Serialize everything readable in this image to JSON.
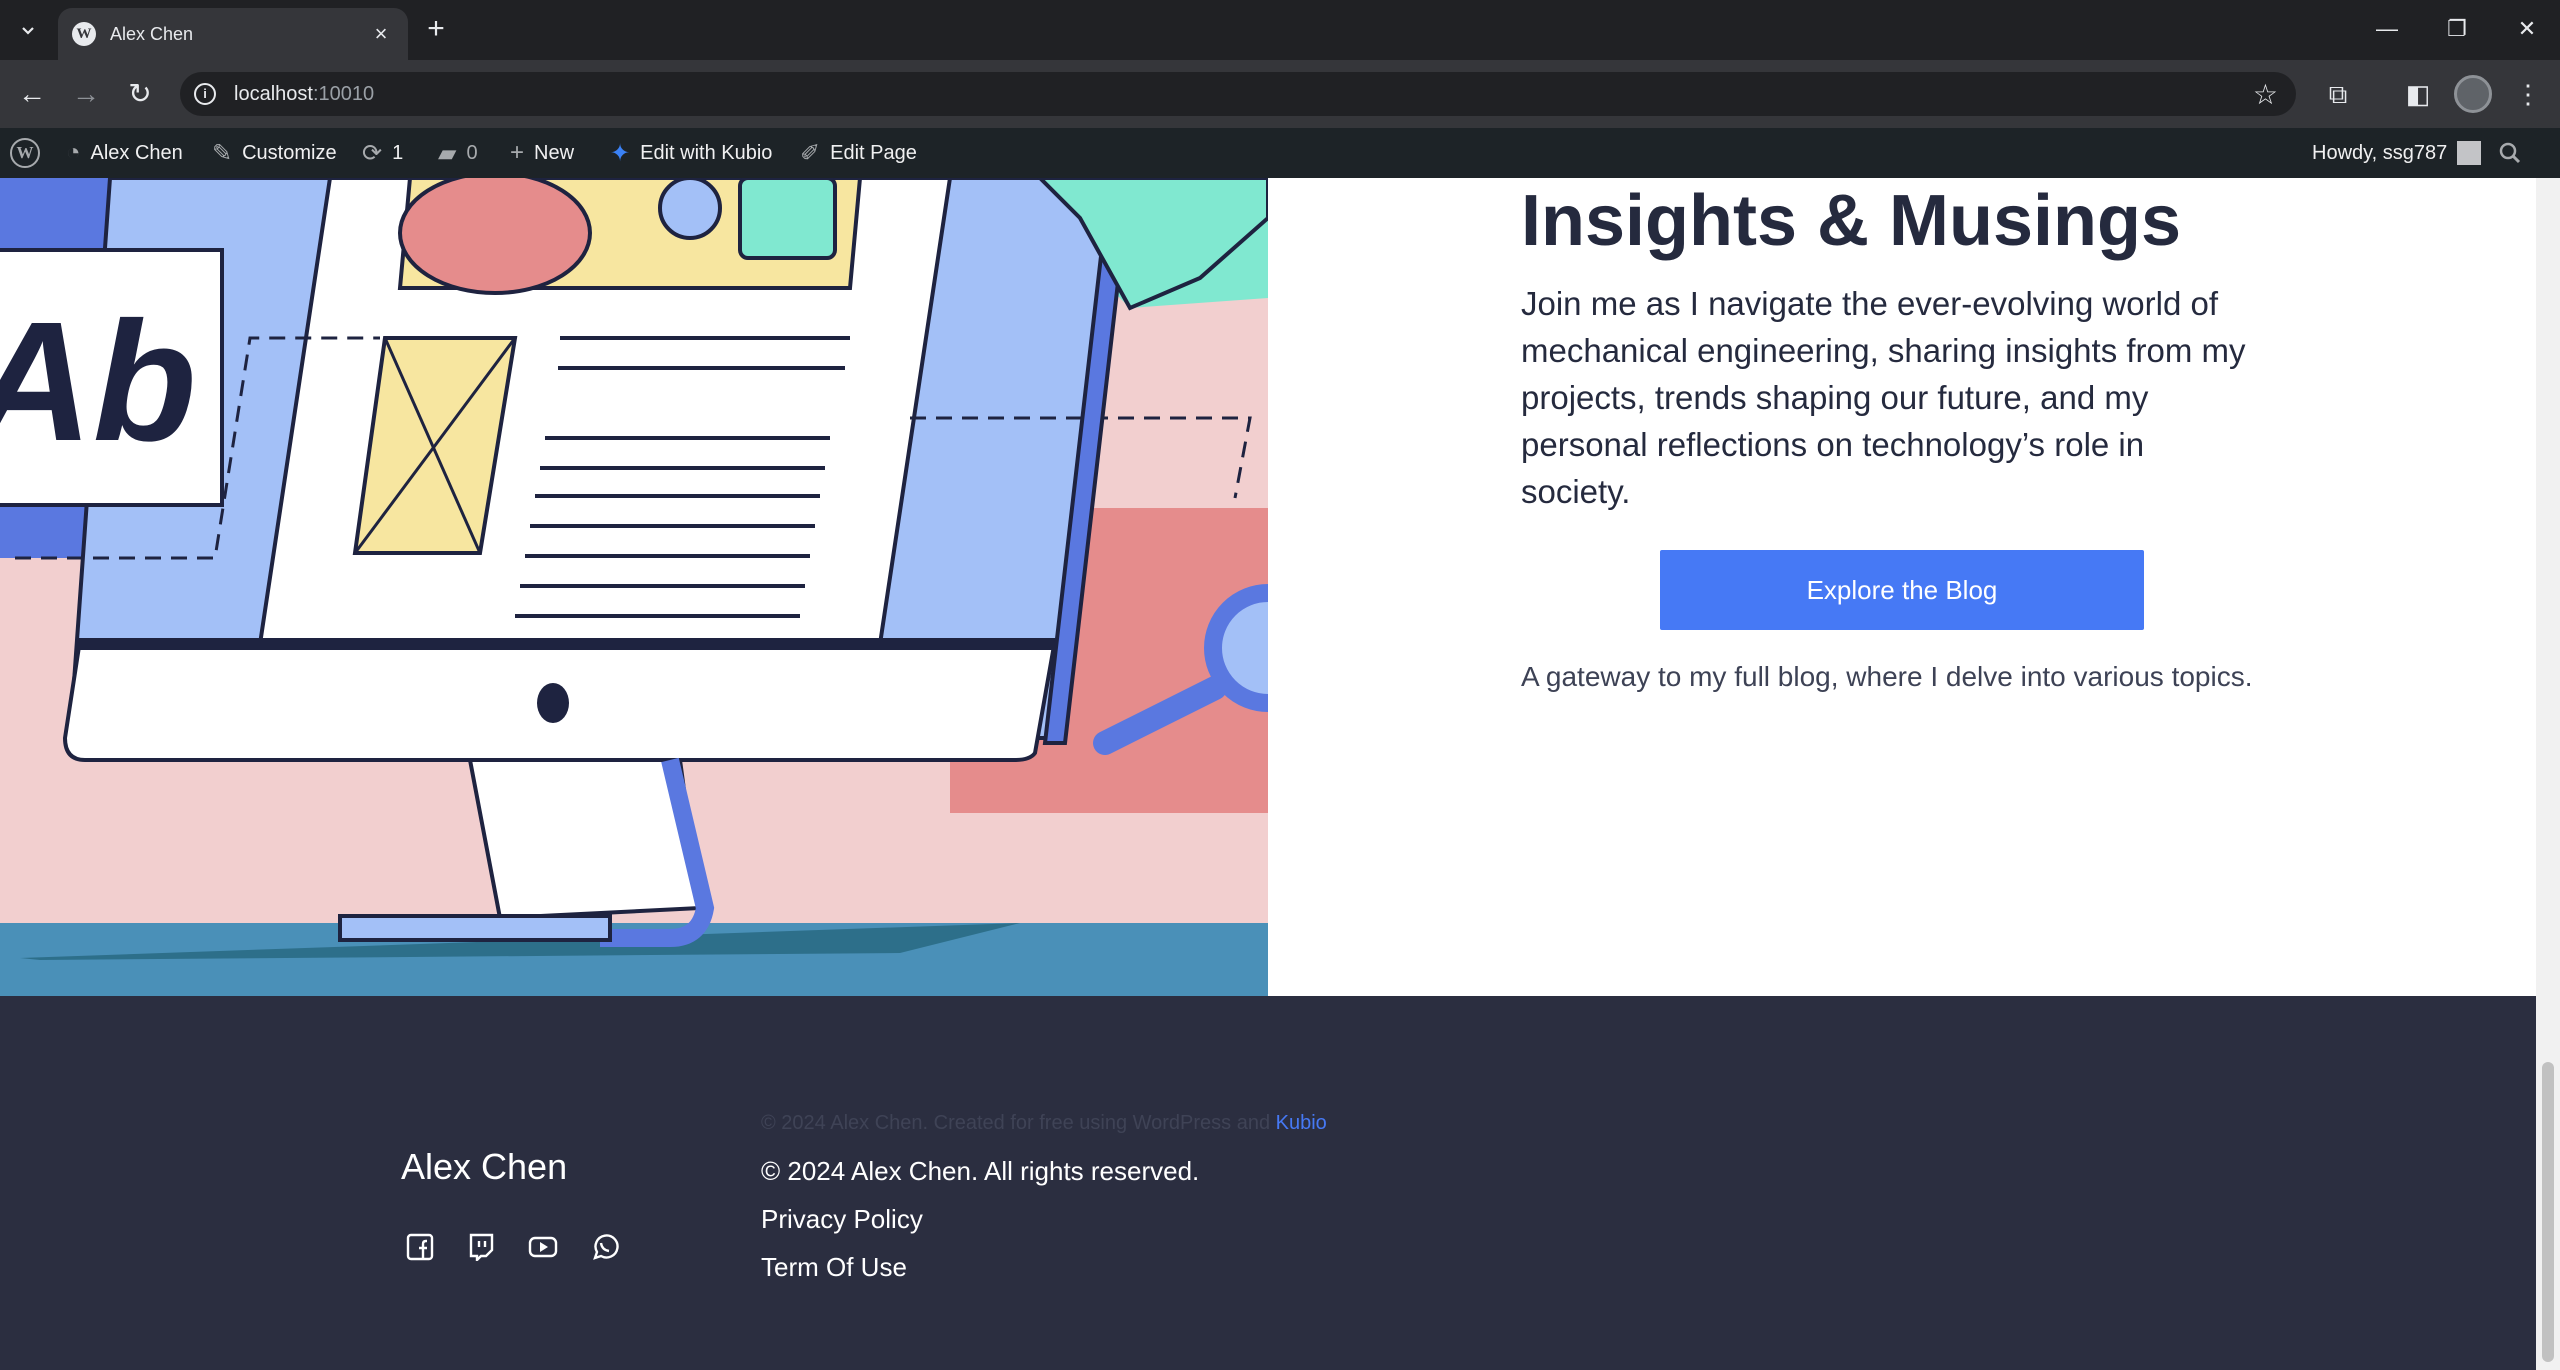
{
  "browser": {
    "tab_title": "Alex Chen",
    "url_host": "localhost",
    "url_port": ":10010"
  },
  "admin_bar": {
    "site_name": "Alex Chen",
    "customize": "Customize",
    "updates": "1",
    "comments": "0",
    "new": "New",
    "edit_kubio": "Edit with Kubio",
    "edit_page": "Edit Page",
    "howdy": "Howdy, ssg787"
  },
  "hero": {
    "title": "Insights & Musings",
    "body": "Join me as I navigate the ever-evolving world of mechanical engineering, sharing insights from my projects, trends shaping our future, and my personal reflections on technology’s role in society.",
    "button": "Explore the Blog",
    "caption": "A gateway to my full blog, where I delve into various topics."
  },
  "footer": {
    "brand": "Alex Chen",
    "credit_text": "© 2024 Alex Chen. Created for free using WordPress and",
    "credit_link": "Kubio",
    "rights": "© 2024 Alex Chen. All rights reserved.",
    "privacy": "Privacy Policy",
    "terms": "Term Of Use",
    "social_icons": [
      "facebook-icon",
      "twitch-icon",
      "youtube-icon",
      "whatsapp-icon"
    ]
  },
  "colors": {
    "accent": "#4679f5",
    "footer_bg": "#2b2e40",
    "title": "#252a3e"
  }
}
